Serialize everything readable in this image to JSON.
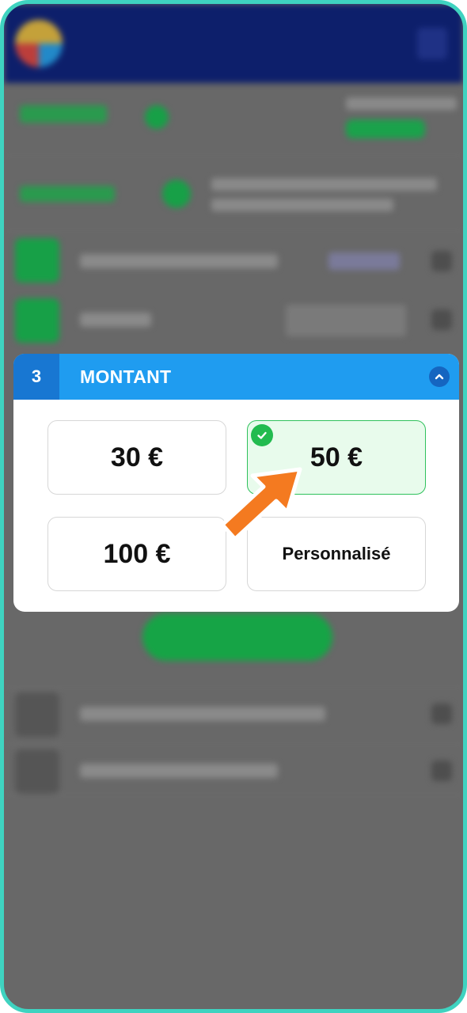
{
  "step": {
    "number": "3",
    "title": "MONTANT"
  },
  "amounts": [
    {
      "label": "30 €",
      "selected": false
    },
    {
      "label": "50 €",
      "selected": true
    },
    {
      "label": "100 €",
      "selected": false
    },
    {
      "label": "Personnalisé",
      "selected": false
    }
  ],
  "icons": {
    "collapse": "chevron-up-icon",
    "selected": "check-icon",
    "pointer": "arrow-pointer-icon"
  },
  "colors": {
    "header": "#1f9cf0",
    "step_badge": "#1877d2",
    "selected_fill": "#e8fbec",
    "selected_border": "#2fc15c",
    "check": "#22bb4f",
    "pointer": "#f47a20",
    "frame_border": "#3fd3c0"
  }
}
